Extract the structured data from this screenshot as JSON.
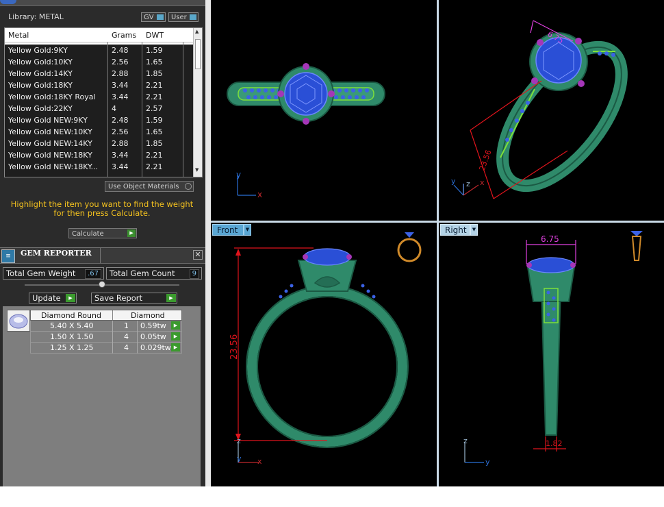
{
  "library": {
    "label": "Library: METAL",
    "toggles": [
      {
        "label": "GV"
      },
      {
        "label": "User"
      }
    ],
    "columns": [
      "Metal",
      "Grams",
      "DWT"
    ],
    "rows": [
      {
        "metal": "Yellow Gold:9KY",
        "grams": "2.48",
        "dwt": "1.59"
      },
      {
        "metal": "Yellow Gold:10KY",
        "grams": "2.56",
        "dwt": "1.65"
      },
      {
        "metal": "Yellow Gold:14KY",
        "grams": "2.88",
        "dwt": "1.85"
      },
      {
        "metal": "Yellow Gold:18KY",
        "grams": "3.44",
        "dwt": "2.21"
      },
      {
        "metal": "Yellow Gold:18KY Royal",
        "grams": "3.44",
        "dwt": "2.21"
      },
      {
        "metal": "Yellow Gold:22KY",
        "grams": "4",
        "dwt": "2.57"
      },
      {
        "metal": "Yellow Gold NEW:9KY",
        "grams": "2.48",
        "dwt": "1.59"
      },
      {
        "metal": "Yellow Gold NEW:10KY",
        "grams": "2.56",
        "dwt": "1.65"
      },
      {
        "metal": "Yellow Gold NEW:14KY",
        "grams": "2.88",
        "dwt": "1.85"
      },
      {
        "metal": "Yellow Gold NEW:18KY",
        "grams": "3.44",
        "dwt": "2.21"
      },
      {
        "metal": "Yellow Gold NEW:18KY...",
        "grams": "3.44",
        "dwt": "2.21"
      }
    ],
    "use_object_materials": "Use Object Materials",
    "hint": "Highlight the item you want to find the weight for then press Calculate.",
    "calculate": "Calculate"
  },
  "gem_reporter": {
    "title": "GEM REPORTER",
    "total_weight_label": "Total Gem Weight",
    "total_weight_value": ".67",
    "total_count_label": "Total Gem Count",
    "total_count_value": "9",
    "update_label": "Update",
    "save_report_label": "Save Report",
    "table_headers": [
      "Diamond Round",
      "Diamond"
    ],
    "rows": [
      {
        "size": "5.40 X 5.40",
        "count": "1",
        "weight": "0.59tw"
      },
      {
        "size": "1.50 X 1.50",
        "count": "4",
        "weight": "0.05tw"
      },
      {
        "size": "1.25 X 1.25",
        "count": "4",
        "weight": "0.029tw"
      }
    ]
  },
  "viewports": {
    "top": {
      "axis_y": "y",
      "axis_x": "x"
    },
    "perspective": {
      "axis_y": "y",
      "axis_z": "z",
      "axis_x": "x",
      "dim_a": "6.75",
      "dim_b": "23.56"
    },
    "front": {
      "tab": "Front",
      "dim": "23.56",
      "axis_z": "z",
      "axis_y": "y",
      "axis_x": "x"
    },
    "right": {
      "tab": "Right",
      "dim_top": "6.75",
      "dim_bottom": "1.82",
      "axis_z": "z",
      "axis_y": "y"
    }
  },
  "colors": {
    "metal_green": "#2f8a6a",
    "gem_blue": "#2a4fd6",
    "accent_green": "#7ee03a",
    "dim_red": "#e0141c",
    "dim_magenta": "#e040e0",
    "hint_yellow": "#f4c21f"
  }
}
